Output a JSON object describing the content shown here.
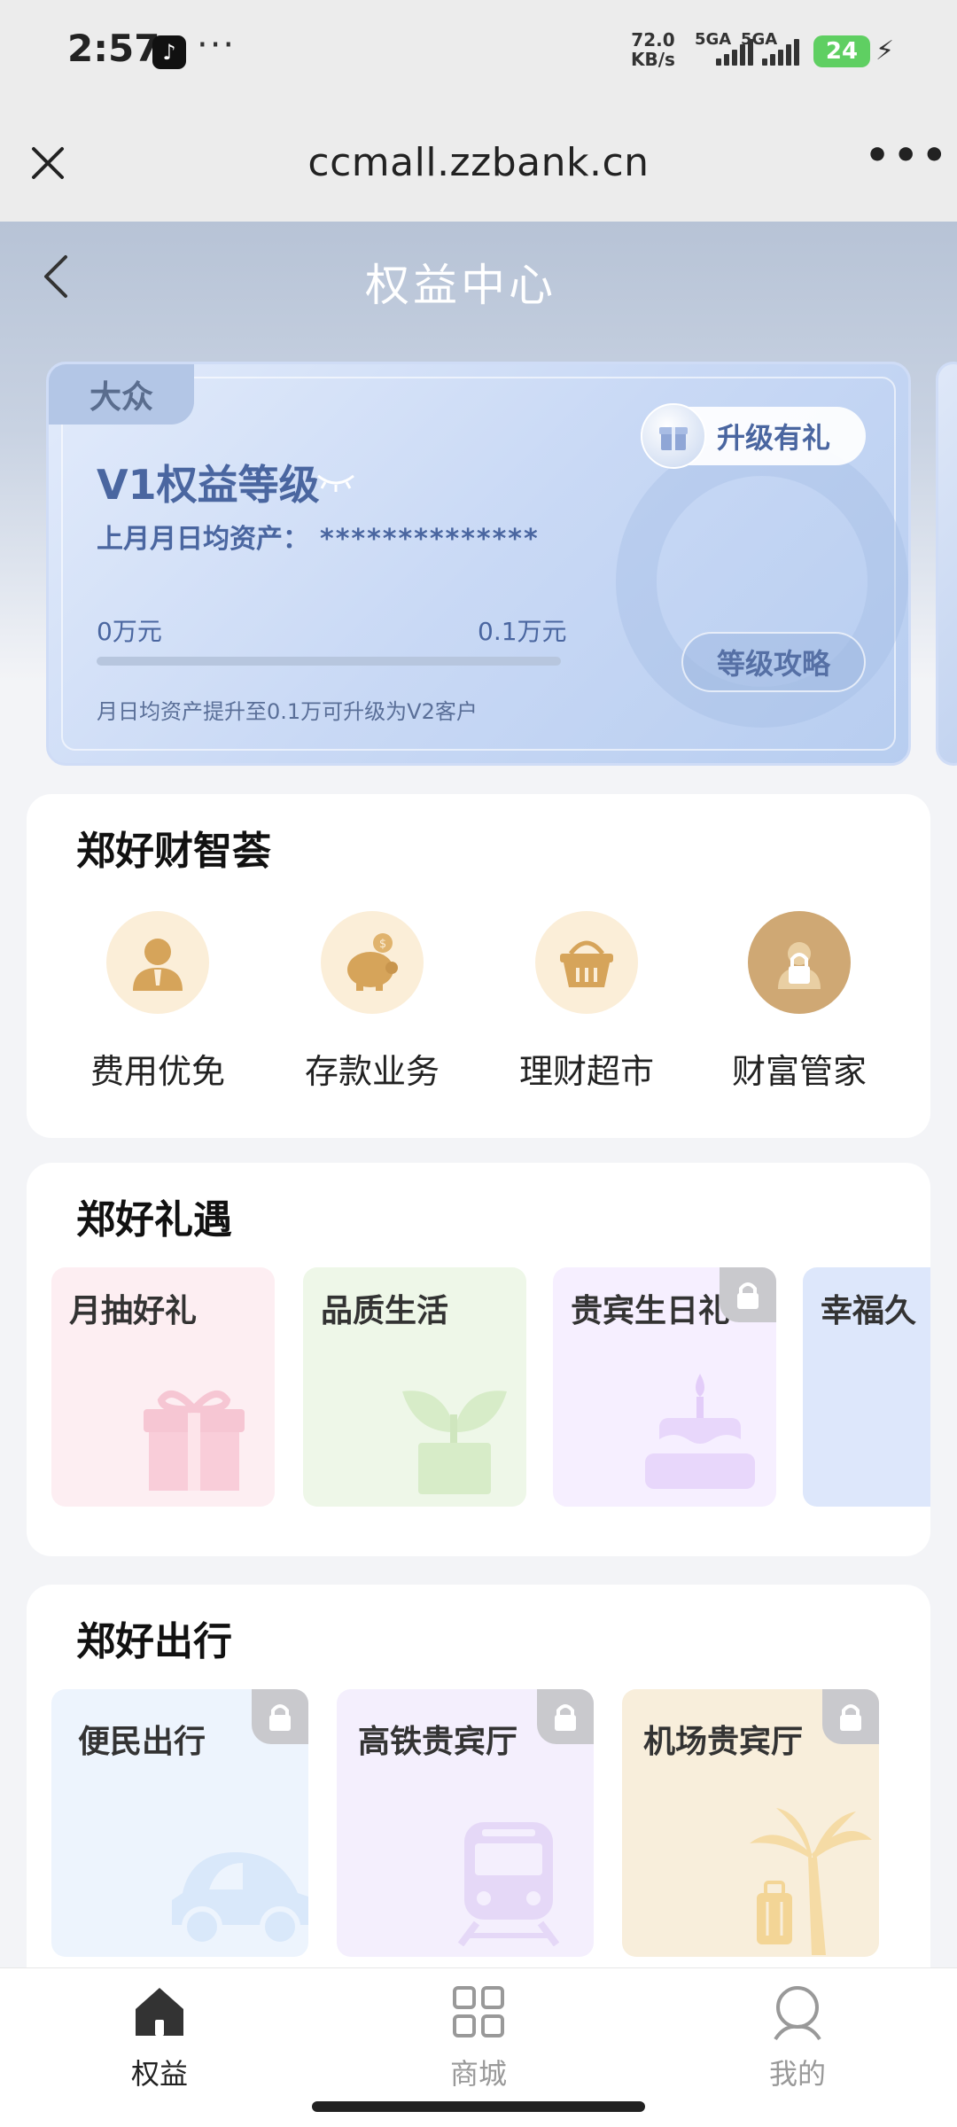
{
  "status_bar": {
    "time": "2:57",
    "net_speed_value": "72.0",
    "net_speed_unit": "KB/s",
    "signal1_label": "5GA",
    "signal2_label": "5GA",
    "battery": "24"
  },
  "browser": {
    "url": "ccmall.zzbank.cn"
  },
  "header": {
    "title": "权益中心"
  },
  "level_card": {
    "tag": "大众",
    "level": "V1权益等级",
    "asset_label": "上月月日均资产：",
    "asset_value": "**************",
    "upgrade_label": "升级有礼",
    "progress_min": "0万元",
    "progress_max": "0.1万元",
    "progress_fraction": 0,
    "guide_label": "等级攻略",
    "hint": "月日均资产提升至0.1万可升级为V2客户"
  },
  "wealth_section": {
    "title": "郑好财智荟",
    "items": [
      {
        "label": "费用优免",
        "icon": "advisor-person-icon"
      },
      {
        "label": "存款业务",
        "icon": "piggy-bank-icon"
      },
      {
        "label": "理财超市",
        "icon": "shopping-basket-icon"
      },
      {
        "label": "财富管家",
        "icon": "lock-icon"
      }
    ]
  },
  "gift_section": {
    "title": "郑好礼遇",
    "items": [
      {
        "label": "月抽好礼",
        "icon": "gift-box-icon",
        "color": "#fdeef2"
      },
      {
        "label": "品质生活",
        "icon": "plant-pot-icon",
        "color": "#eef7e8"
      },
      {
        "label": "贵宾生日礼",
        "icon": "birthday-cake-icon",
        "color": "#f6efff",
        "locked": true
      },
      {
        "label": "幸福久",
        "icon": "partial-card",
        "color": "#dde7fb"
      }
    ]
  },
  "travel_section": {
    "title": "郑好出行",
    "items": [
      {
        "label": "便民出行",
        "icon": "car-icon",
        "color": "#edf4fd",
        "locked": true
      },
      {
        "label": "高铁贵宾厅",
        "icon": "train-icon",
        "color": "#f4effd",
        "locked": true
      },
      {
        "label": "机场贵宾厅",
        "icon": "palm-luggage-icon",
        "color": "#f8eedb",
        "locked": true
      }
    ]
  },
  "bottom_nav": {
    "items": [
      {
        "label": "权益",
        "active": true
      },
      {
        "label": "商城",
        "active": false
      },
      {
        "label": "我的",
        "active": false
      }
    ]
  }
}
